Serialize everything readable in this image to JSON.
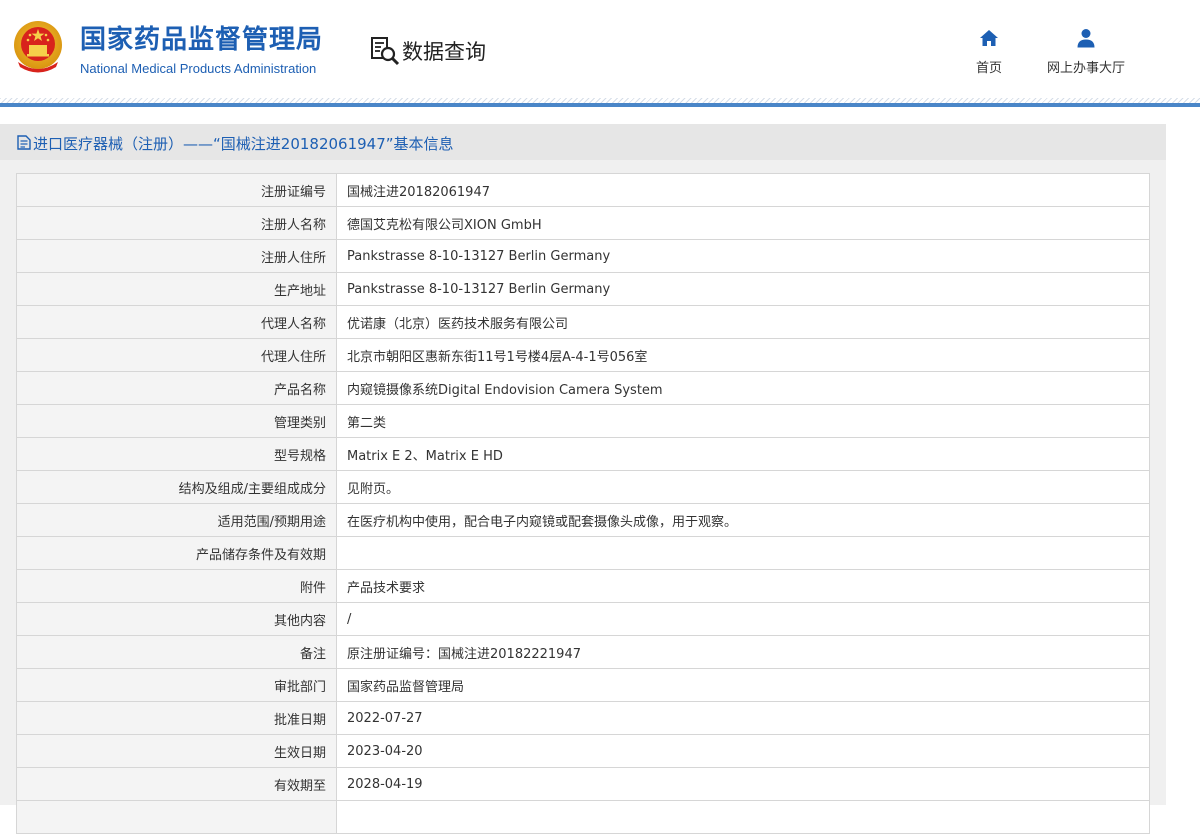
{
  "header": {
    "title_cn": "国家药品监督管理局",
    "title_en": "National Medical Products Administration",
    "data_query": "数据查询",
    "nav": [
      {
        "label": "首页",
        "icon": "home-icon"
      },
      {
        "label": "网上办事大厅",
        "icon": "user-icon"
      }
    ]
  },
  "panel": {
    "title": "进口医疗器械（注册）——“国械注进20182061947”基本信息"
  },
  "colors": {
    "brand": "#1d5fb3",
    "border": "#d6d6d6",
    "label_bg": "#f4f4f4"
  },
  "rows": [
    {
      "label": "注册证编号",
      "value": "国械注进20182061947"
    },
    {
      "label": "注册人名称",
      "value": "德国艾克松有限公司XION GmbH"
    },
    {
      "label": "注册人住所",
      "value": "Pankstrasse 8-10-13127 Berlin Germany"
    },
    {
      "label": "生产地址",
      "value": "Pankstrasse 8-10-13127 Berlin Germany"
    },
    {
      "label": "代理人名称",
      "value": "优诺康（北京）医药技术服务有限公司"
    },
    {
      "label": "代理人住所",
      "value": "北京市朝阳区惠新东街11号1号楼4层A-4-1号056室"
    },
    {
      "label": "产品名称",
      "value": "内窥镜摄像系统Digital Endovision Camera System"
    },
    {
      "label": "管理类别",
      "value": "第二类"
    },
    {
      "label": "型号规格",
      "value": "Matrix E 2、Matrix E HD"
    },
    {
      "label": "结构及组成/主要组成成分",
      "value": "见附页。"
    },
    {
      "label": "适用范围/预期用途",
      "value": "在医疗机构中使用，配合电子内窥镜或配套摄像头成像，用于观察。"
    },
    {
      "label": "产品储存条件及有效期",
      "value": ""
    },
    {
      "label": "附件",
      "value": "产品技术要求"
    },
    {
      "label": "其他内容",
      "value": "/"
    },
    {
      "label": "备注",
      "value": "原注册证编号：国械注进20182221947"
    },
    {
      "label": "审批部门",
      "value": "国家药品监督管理局"
    },
    {
      "label": "批准日期",
      "value": "2022-07-27"
    },
    {
      "label": "生效日期",
      "value": "2023-04-20"
    },
    {
      "label": "有效期至",
      "value": "2028-04-19"
    },
    {
      "label": "",
      "value": ""
    }
  ]
}
